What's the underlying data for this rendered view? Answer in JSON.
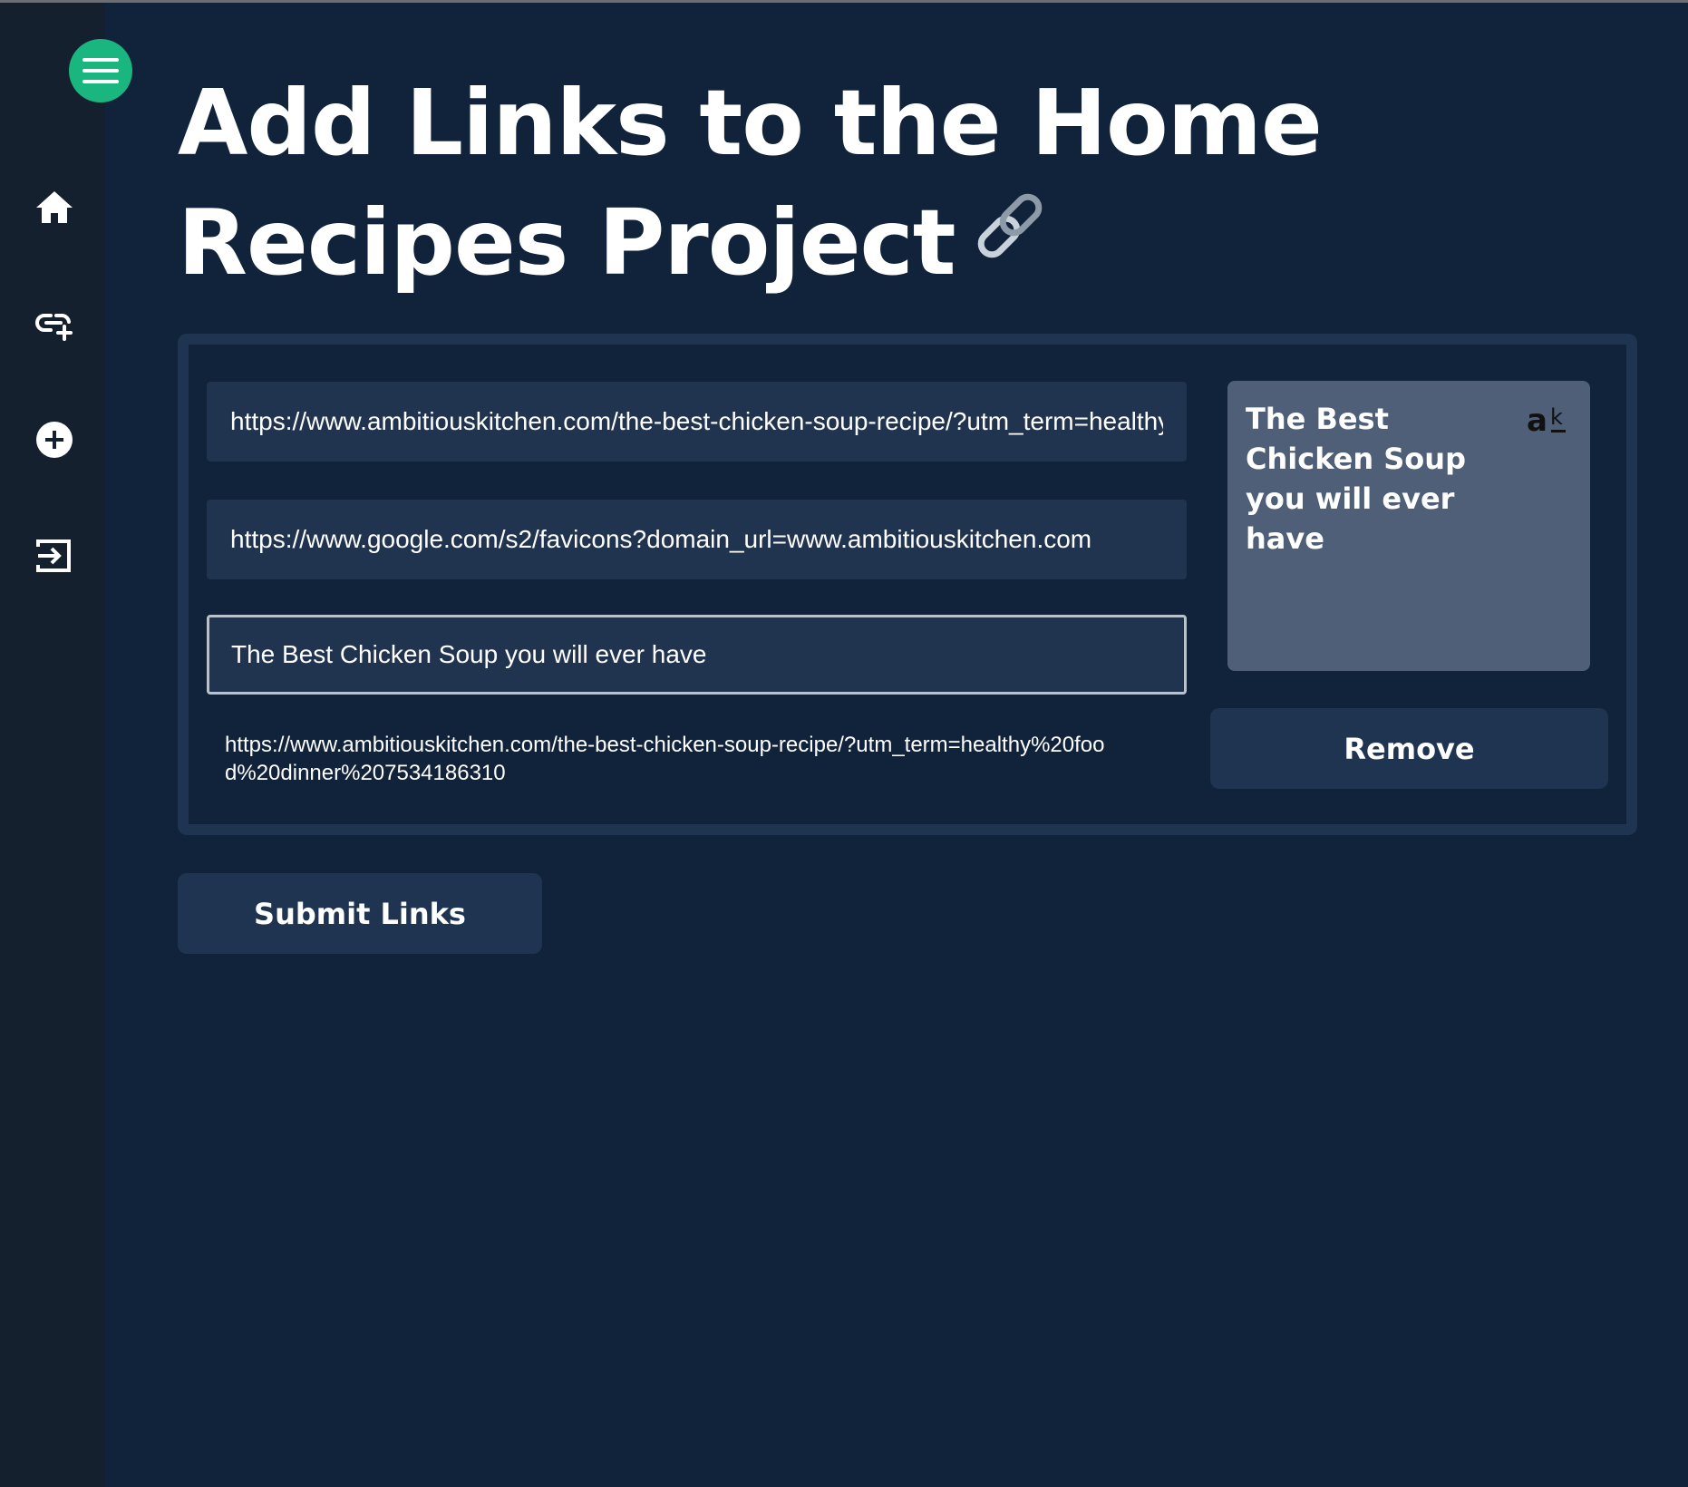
{
  "sidebar": {
    "menu_icon": "hamburger-menu-icon",
    "items": [
      {
        "icon": "home-icon"
      },
      {
        "icon": "add-link-icon"
      },
      {
        "icon": "add-circle-icon"
      },
      {
        "icon": "logout-icon"
      }
    ],
    "accent_color": "#19b77f"
  },
  "page": {
    "title": "Add Links to the Home Recipes Project",
    "title_icon": "link-chain-icon"
  },
  "form": {
    "url_value": "https://www.ambitiouskitchen.com/the-best-chicken-soup-recipe/?utm_term=healthy%20food%20dinner%207534186310",
    "favicon_url_value": "https://www.google.com/s2/favicons?domain_url=www.ambitiouskitchen.com",
    "title_value": "The Best Chicken Soup you will ever have",
    "link_display": "https://www.ambitiouskitchen.com/the-best-chicken-soup-recipe/?utm_term=healthy%20food%20dinner%207534186310"
  },
  "preview_card": {
    "title": "The Best Chicken Soup you will ever have",
    "favicon_text": "ak"
  },
  "buttons": {
    "remove": "Remove",
    "submit": "Submit Links"
  }
}
